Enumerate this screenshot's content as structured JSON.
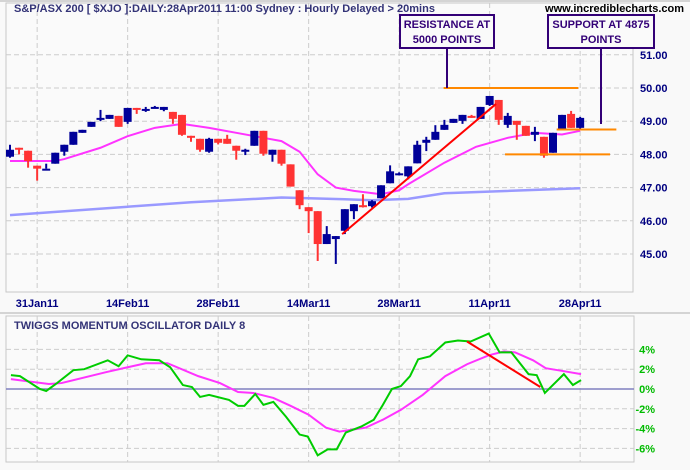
{
  "header": {
    "title": "S&P/ASX 200 [ $XJO ]:DAILY:28Apr2011 11:00 Sydney : Hourly Delayed > 20mins",
    "site": "www.incrediblecharts.com"
  },
  "annotations": {
    "resistance": {
      "line1": "RESISTANCE AT",
      "line2": "5000 POINTS",
      "level": 50.0
    },
    "support": {
      "line1": "SUPPORT AT 4875",
      "line2": "POINTS",
      "level": 48.75
    },
    "support2_level": 48.0
  },
  "colors": {
    "up": "#000099",
    "down": "#ff3333",
    "ma_short": "#ff33ff",
    "ma_long": "#9999ff",
    "osc": "#00cc00",
    "osc_signal": "#ff33ff",
    "trend": "#ff0000",
    "level": "#ff8800",
    "label": "#000080",
    "box": "#330077"
  },
  "chart_data": [
    {
      "type": "candlestick",
      "title": "S&P/ASX 200 [ $XJO ]:DAILY",
      "ylim": [
        44.5,
        51.5
      ],
      "yticks": [
        "51.00",
        "50.00",
        "49.00",
        "48.00",
        "47.00",
        "46.00",
        "45.00"
      ],
      "ytick_values": [
        51,
        50,
        49,
        48,
        47,
        46,
        45
      ],
      "xticks": [
        {
          "label": "31Jan11",
          "i": 3
        },
        {
          "label": "14Feb11",
          "i": 13
        },
        {
          "label": "28Feb11",
          "i": 23
        },
        {
          "label": "14Mar11",
          "i": 33
        },
        {
          "label": "28Mar11",
          "i": 43
        },
        {
          "label": "11Apr11",
          "i": 53
        },
        {
          "label": "28Apr11",
          "i": 63
        }
      ],
      "ohlc": [
        [
          47.93,
          48.29,
          47.9,
          48.14
        ],
        [
          48.2,
          48.2,
          48.0,
          48.14
        ],
        [
          48.11,
          48.11,
          47.6,
          47.8
        ],
        [
          47.66,
          47.66,
          47.21,
          47.57
        ],
        [
          47.57,
          47.72,
          47.57,
          47.57
        ],
        [
          47.72,
          48.05,
          47.72,
          48.05
        ],
        [
          48.08,
          48.29,
          47.96,
          48.29
        ],
        [
          48.29,
          48.68,
          48.29,
          48.68
        ],
        [
          48.65,
          48.74,
          48.65,
          48.74
        ],
        [
          48.83,
          48.98,
          48.83,
          48.98
        ],
        [
          49.04,
          49.34,
          49.0,
          49.1
        ],
        [
          49.07,
          49.19,
          49.07,
          49.19
        ],
        [
          49.16,
          49.16,
          48.83,
          48.83
        ],
        [
          48.98,
          49.4,
          48.92,
          49.4
        ],
        [
          49.4,
          49.4,
          49.22,
          49.37
        ],
        [
          49.31,
          49.43,
          49.28,
          49.37
        ],
        [
          49.4,
          49.46,
          49.4,
          49.43
        ],
        [
          49.34,
          49.43,
          49.3,
          49.43
        ],
        [
          49.28,
          49.28,
          48.92,
          49.07
        ],
        [
          49.19,
          49.19,
          48.56,
          48.59
        ],
        [
          48.56,
          48.56,
          48.38,
          48.53
        ],
        [
          48.47,
          48.47,
          48.08,
          48.14
        ],
        [
          48.08,
          48.5,
          48.05,
          48.47
        ],
        [
          48.47,
          48.47,
          48.3,
          48.35
        ],
        [
          48.47,
          48.59,
          48.32,
          48.32
        ],
        [
          48.26,
          48.26,
          47.84,
          48.11
        ],
        [
          48.11,
          48.17,
          47.98,
          48.14
        ],
        [
          48.26,
          48.71,
          48.26,
          48.71
        ],
        [
          48.71,
          48.71,
          47.96,
          48.02
        ],
        [
          47.99,
          48.14,
          47.78,
          48.14
        ],
        [
          48.14,
          48.14,
          47.66,
          47.72
        ],
        [
          47.7,
          47.7,
          47.03,
          47.03
        ],
        [
          46.92,
          46.92,
          46.35,
          46.47
        ],
        [
          46.41,
          46.41,
          45.63,
          46.29
        ],
        [
          46.29,
          46.29,
          44.79,
          45.3
        ],
        [
          45.3,
          45.84,
          45.3,
          45.6
        ],
        [
          45.45,
          45.54,
          44.7,
          45.54
        ],
        [
          45.7,
          46.35,
          45.6,
          46.35
        ],
        [
          46.29,
          46.5,
          46.05,
          46.5
        ],
        [
          46.47,
          46.8,
          46.4,
          46.44
        ],
        [
          46.44,
          46.62,
          46.4,
          46.59
        ],
        [
          46.68,
          47.07,
          46.68,
          47.07
        ],
        [
          47.13,
          47.67,
          47.13,
          47.49
        ],
        [
          47.4,
          47.46,
          47.37,
          47.43
        ],
        [
          47.34,
          47.64,
          47.25,
          47.64
        ],
        [
          47.73,
          48.41,
          47.73,
          48.29
        ],
        [
          48.35,
          48.53,
          48.1,
          48.44
        ],
        [
          48.44,
          48.88,
          48.44,
          48.68
        ],
        [
          48.74,
          49.04,
          48.74,
          48.89
        ],
        [
          48.95,
          49.07,
          48.95,
          49.07
        ],
        [
          49.01,
          49.19,
          48.92,
          49.19
        ],
        [
          49.16,
          49.19,
          49.1,
          49.13
        ],
        [
          49.07,
          49.43,
          49.07,
          49.43
        ],
        [
          49.49,
          49.76,
          49.46,
          49.76
        ],
        [
          49.64,
          49.64,
          48.89,
          49.04
        ],
        [
          48.89,
          49.25,
          48.8,
          49.16
        ],
        [
          49.01,
          49.01,
          48.44,
          48.89
        ],
        [
          48.86,
          48.86,
          48.56,
          48.56
        ],
        [
          48.59,
          48.83,
          48.4,
          48.68
        ],
        [
          48.53,
          48.53,
          47.9,
          47.96
        ],
        [
          48.05,
          48.65,
          48.05,
          48.65
        ],
        [
          48.74,
          49.19,
          48.74,
          49.19
        ],
        [
          49.22,
          49.31,
          48.8,
          48.8
        ],
        [
          48.8,
          49.13,
          48.77,
          49.1
        ]
      ],
      "ma_short": [
        [
          0,
          47.8
        ],
        [
          5,
          47.8
        ],
        [
          6,
          47.86
        ],
        [
          10,
          48.2
        ],
        [
          13,
          48.55
        ],
        [
          16,
          48.8
        ],
        [
          19,
          48.92
        ],
        [
          22,
          48.8
        ],
        [
          25,
          48.65
        ],
        [
          28,
          48.5
        ],
        [
          30,
          48.4
        ],
        [
          32,
          48.08
        ],
        [
          34,
          47.4
        ],
        [
          36,
          47.0
        ],
        [
          38,
          46.9
        ],
        [
          41,
          46.8
        ],
        [
          43,
          46.92
        ],
        [
          44,
          47.1
        ],
        [
          48,
          47.75
        ],
        [
          51.5,
          48.23
        ],
        [
          55,
          48.5
        ],
        [
          58,
          48.65
        ],
        [
          61,
          48.6
        ],
        [
          63,
          48.71
        ]
      ],
      "ma_long": [
        [
          0,
          46.17
        ],
        [
          20,
          46.56
        ],
        [
          30,
          46.7
        ],
        [
          37,
          46.65
        ],
        [
          40,
          46.62
        ],
        [
          44,
          46.66
        ],
        [
          48,
          46.83
        ],
        [
          63,
          46.98
        ]
      ],
      "trendline": [
        [
          36.7,
          45.6
        ],
        [
          53.7,
          49.52
        ]
      ],
      "levels": [
        {
          "price": 50.0,
          "from": 47.9,
          "to": 62.8
        },
        {
          "price": 48.0,
          "from": 54.7,
          "to": 66.3
        },
        {
          "price": 48.75,
          "from": 60.4,
          "to": 67.0
        }
      ]
    },
    {
      "type": "line",
      "title": "TWIGGS MOMENTUM OSCILLATOR DAILY 8",
      "ylim": [
        -7,
        6.5
      ],
      "yticks": [
        "4%",
        "2%",
        "0%",
        "-2%",
        "-4%",
        "-6%"
      ],
      "ytick_values": [
        4,
        2,
        0,
        -2,
        -4,
        -6
      ],
      "series": [
        {
          "name": "oscillator",
          "points": [
            [
              0.1,
              1.4
            ],
            [
              1.1,
              1.3
            ],
            [
              3.3,
              0
            ],
            [
              4,
              -0.2
            ],
            [
              5.2,
              0.6
            ],
            [
              7,
              1.9
            ],
            [
              8.2,
              2.0
            ],
            [
              10.8,
              2.9
            ],
            [
              12,
              2.3
            ],
            [
              13,
              3.4
            ],
            [
              14.5,
              3.0
            ],
            [
              16.5,
              2.9
            ],
            [
              17.7,
              2.2
            ],
            [
              19.1,
              0.4
            ],
            [
              20.1,
              0.2
            ],
            [
              21,
              -0.8
            ],
            [
              22,
              -0.6
            ],
            [
              24.2,
              -1.1
            ],
            [
              25.2,
              -1.7
            ],
            [
              25.9,
              -1.7
            ],
            [
              27.1,
              -0.5
            ],
            [
              28,
              -1.6
            ],
            [
              29.1,
              -1.3
            ],
            [
              30.5,
              -2.8
            ],
            [
              32,
              -4.6
            ],
            [
              32.9,
              -4.8
            ],
            [
              34,
              -6.7
            ],
            [
              35.1,
              -6.1
            ],
            [
              36.1,
              -6.1
            ],
            [
              37.1,
              -4.4
            ],
            [
              38.8,
              -3.8
            ],
            [
              40.2,
              -3.1
            ],
            [
              41.2,
              -1.6
            ],
            [
              42.2,
              0
            ],
            [
              43.2,
              0.3
            ],
            [
              44.2,
              1.3
            ],
            [
              45.1,
              3.0
            ],
            [
              46.4,
              3.3
            ],
            [
              48.1,
              4.7
            ],
            [
              49.5,
              4.9
            ],
            [
              50.9,
              4.8
            ],
            [
              52.9,
              5.6
            ],
            [
              54.1,
              3.7
            ],
            [
              55.4,
              3.7
            ],
            [
              57.3,
              1.5
            ],
            [
              58.2,
              1.4
            ],
            [
              59.1,
              -0.4
            ],
            [
              61.2,
              1.5
            ],
            [
              62.2,
              0.4
            ],
            [
              63.1,
              0.9
            ]
          ]
        },
        {
          "name": "signal",
          "points": [
            [
              0.1,
              1.0
            ],
            [
              4.3,
              0.5
            ],
            [
              5.7,
              0.6
            ],
            [
              10.6,
              1.7
            ],
            [
              13,
              2.2
            ],
            [
              15,
              2.6
            ],
            [
              17.4,
              2.6
            ],
            [
              20.8,
              1.3
            ],
            [
              23.2,
              0.6
            ],
            [
              25.2,
              -0.3
            ],
            [
              26.9,
              -0.4
            ],
            [
              29.1,
              -0.9
            ],
            [
              31,
              -1.7
            ],
            [
              33,
              -2.6
            ],
            [
              34.9,
              -3.9
            ],
            [
              36.4,
              -4.3
            ],
            [
              39.3,
              -3.9
            ],
            [
              41.2,
              -3.1
            ],
            [
              43.2,
              -2.1
            ],
            [
              45.6,
              -0.6
            ],
            [
              48.1,
              1.3
            ],
            [
              50.5,
              2.5
            ],
            [
              52.9,
              3.4
            ],
            [
              54.6,
              3.8
            ],
            [
              55.8,
              3.7
            ],
            [
              57.8,
              2.9
            ],
            [
              59.2,
              2.1
            ],
            [
              61.2,
              1.8
            ],
            [
              63.1,
              1.5
            ]
          ]
        }
      ],
      "trendline": [
        [
          50.5,
          4.8
        ],
        [
          58.6,
          0.2
        ]
      ]
    }
  ]
}
